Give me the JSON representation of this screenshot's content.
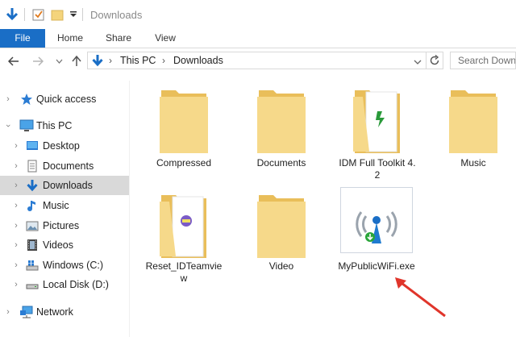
{
  "window": {
    "title": "Downloads"
  },
  "ribbon": {
    "tabs": [
      "File",
      "Home",
      "Share",
      "View"
    ]
  },
  "address": {
    "segments": [
      "This PC",
      "Downloads"
    ],
    "separator": "›"
  },
  "search": {
    "placeholder": "Search Down"
  },
  "sidebar": {
    "items": [
      {
        "label": "Quick access",
        "icon": "star-icon"
      },
      {
        "label": "This PC",
        "icon": "computer-icon"
      },
      {
        "label": "Desktop",
        "icon": "desktop-folder-icon"
      },
      {
        "label": "Documents",
        "icon": "documents-icon"
      },
      {
        "label": "Downloads",
        "icon": "download-arrow-icon"
      },
      {
        "label": "Music",
        "icon": "music-note-icon"
      },
      {
        "label": "Pictures",
        "icon": "pictures-icon"
      },
      {
        "label": "Videos",
        "icon": "film-icon"
      },
      {
        "label": "Windows (C:)",
        "icon": "windows-drive-icon"
      },
      {
        "label": "Local Disk (D:)",
        "icon": "drive-icon"
      },
      {
        "label": "Network",
        "icon": "network-icon"
      }
    ]
  },
  "files": [
    {
      "name": "Compressed",
      "type": "folder"
    },
    {
      "name": "Documents",
      "type": "folder"
    },
    {
      "name": "IDM Full Toolkit 4.2",
      "type": "folder-with-file"
    },
    {
      "name": "Music",
      "type": "folder"
    },
    {
      "name": "Reset_IDTeamview",
      "type": "folder-with-file"
    },
    {
      "name": "Video",
      "type": "folder"
    },
    {
      "name": "MyPublicWiFi.exe",
      "type": "executable"
    }
  ],
  "colors": {
    "accent": "#1a6ec6",
    "folder": "#f4d47c",
    "selected": "#d9d9d9",
    "arrow": "#e0352b"
  }
}
